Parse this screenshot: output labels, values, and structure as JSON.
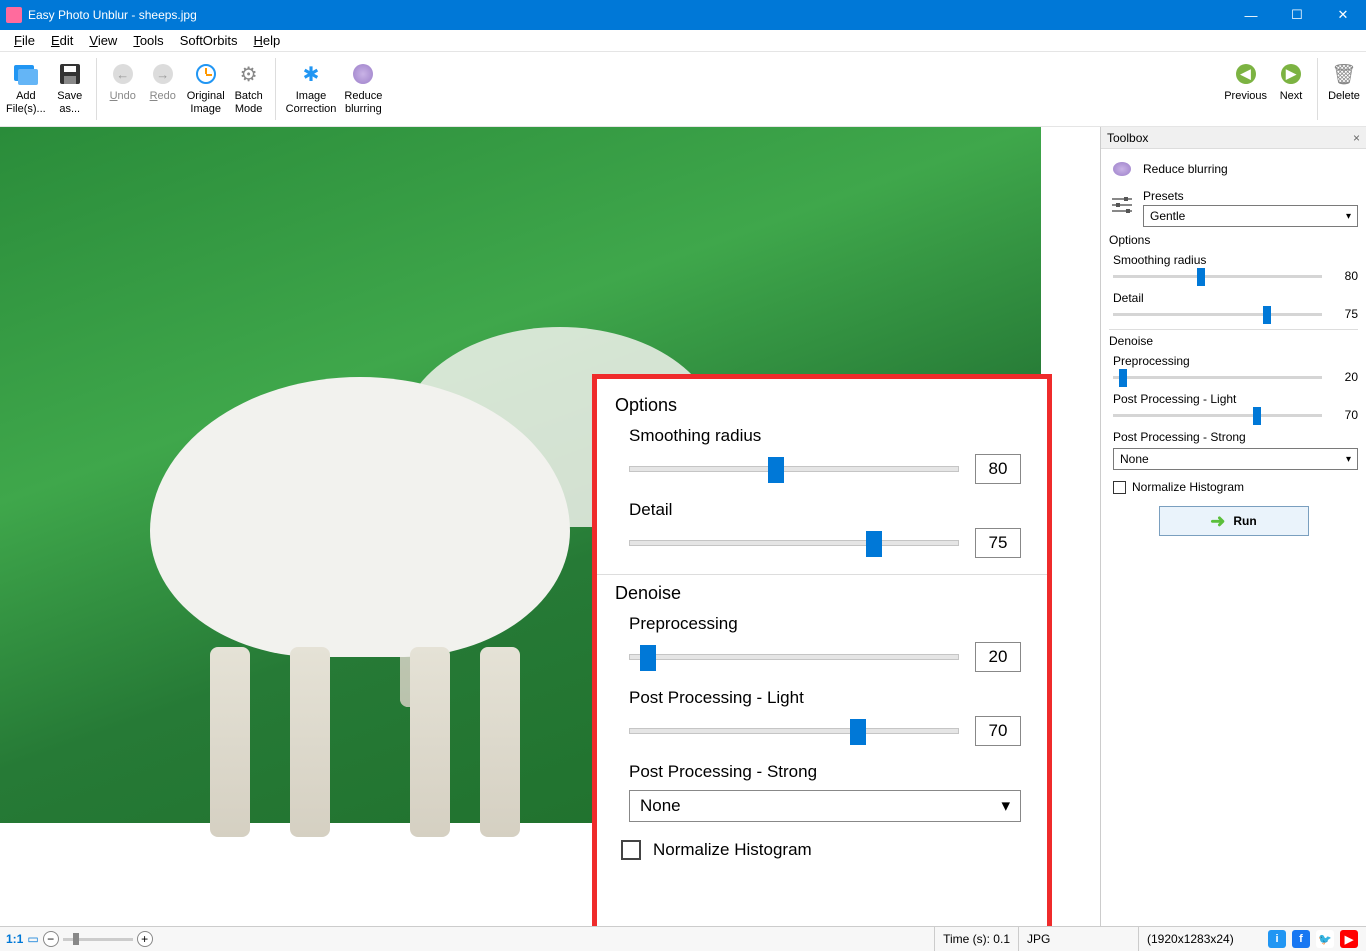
{
  "window": {
    "title": "Easy Photo Unblur - sheeps.jpg"
  },
  "menu": {
    "file": "File",
    "edit": "Edit",
    "view": "View",
    "tools": "Tools",
    "softorbits": "SoftOrbits",
    "help": "Help"
  },
  "toolbar": {
    "add_files": "Add\nFile(s)...",
    "save_as": "Save\nas...",
    "undo": "Undo",
    "redo": "Redo",
    "original_image": "Original\nImage",
    "batch_mode": "Batch\nMode",
    "image_correction": "Image\nCorrection",
    "reduce_blurring": "Reduce\nblurring",
    "previous": "Previous",
    "next": "Next",
    "delete": "Delete"
  },
  "overlay": {
    "options_title": "Options",
    "smoothing_label": "Smoothing radius",
    "smoothing_value": "80",
    "detail_label": "Detail",
    "detail_value": "75",
    "denoise_title": "Denoise",
    "preprocessing_label": "Preprocessing",
    "preprocessing_value": "20",
    "post_light_label": "Post Processing - Light",
    "post_light_value": "70",
    "post_strong_label": "Post Processing - Strong",
    "post_strong_value": "None",
    "normalize_label": "Normalize Histogram"
  },
  "toolbox": {
    "title": "Toolbox",
    "mode": "Reduce blurring",
    "presets_label": "Presets",
    "preset_value": "Gentle",
    "options_title": "Options",
    "smoothing_label": "Smoothing radius",
    "smoothing_value": "80",
    "detail_label": "Detail",
    "detail_value": "75",
    "denoise_title": "Denoise",
    "preprocessing_label": "Preprocessing",
    "preprocessing_value": "20",
    "post_light_label": "Post Processing - Light",
    "post_light_value": "70",
    "post_strong_label": "Post Processing - Strong",
    "post_strong_value": "None",
    "normalize_label": "Normalize Histogram",
    "run": "Run"
  },
  "status": {
    "ratio": "1:1",
    "time": "Time (s): 0.1",
    "format": "JPG",
    "dimensions": "(1920x1283x24)"
  }
}
